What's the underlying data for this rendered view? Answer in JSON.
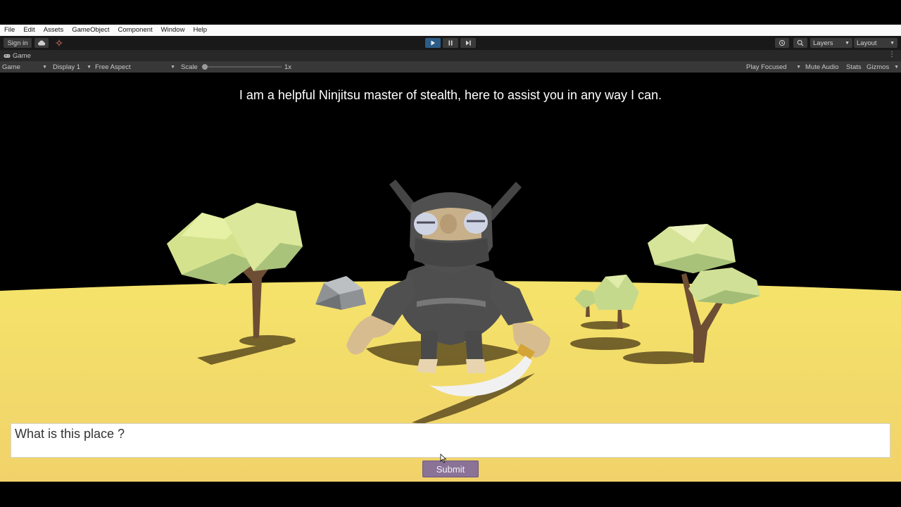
{
  "menu": [
    "File",
    "Edit",
    "Assets",
    "GameObject",
    "Component",
    "Window",
    "Help"
  ],
  "toolbar": {
    "sign_in": "Sign in",
    "layers": "Layers",
    "layout": "Layout",
    "play_active": true
  },
  "tab": {
    "label": "Game"
  },
  "game_bar": {
    "mode": "Game",
    "display": "Display 1",
    "aspect": "Free Aspect",
    "scale_label": "Scale",
    "scale_value": "1x",
    "play_focused": "Play Focused",
    "mute_audio": "Mute Audio",
    "stats": "Stats",
    "gizmos": "Gizmos"
  },
  "game": {
    "dialogue": "I am a helpful Ninjitsu master of stealth, here to assist you in any way I can.",
    "input_value": "What is this place ?",
    "submit_label": "Submit"
  },
  "colors": {
    "ground": "#f3db6a",
    "sky": "#000000",
    "play_button": "#2c5d87",
    "submit_button": "#8a7397"
  }
}
